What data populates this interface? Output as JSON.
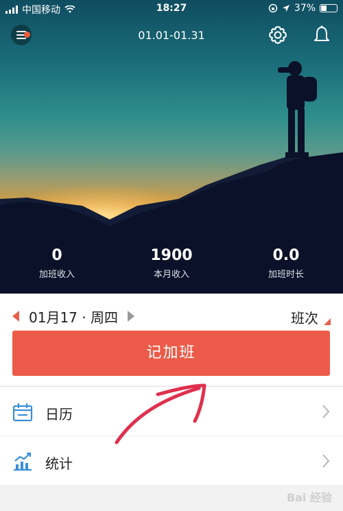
{
  "status_bar": {
    "carrier": "中国移动",
    "time": "18:27",
    "battery": "37%",
    "battery_level": 0.37
  },
  "header": {
    "date_range": "01.01-01.31",
    "icons": [
      "menu-icon",
      "gear-icon",
      "bell-icon"
    ]
  },
  "stats": [
    {
      "value": "0",
      "label": "加班收入"
    },
    {
      "value": "1900",
      "label": "本月收入"
    },
    {
      "value": "0.0",
      "label": "加班时长"
    }
  ],
  "date_selector": {
    "date": "01月17 · 周四",
    "shift_label": "班次"
  },
  "record_button": "记加班",
  "menu": [
    {
      "label": "日历",
      "icon": "calendar-icon"
    },
    {
      "label": "统计",
      "icon": "chart-icon"
    }
  ],
  "watermark": "Bai 经验",
  "colors": {
    "accent": "#ec5b49",
    "icon_blue": "#3a8fd8"
  }
}
